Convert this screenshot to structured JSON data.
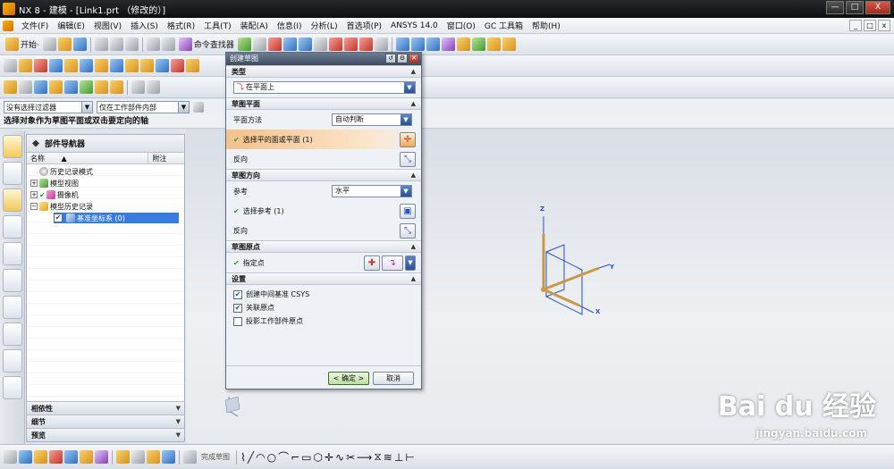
{
  "window": {
    "title": "NX 8 - 建模 - [Link1.prt （修改的）]",
    "s_char": "S",
    "buttons": [
      "—",
      "□",
      "X"
    ]
  },
  "menu": {
    "items": [
      "文件(F)",
      "编辑(E)",
      "视图(V)",
      "插入(S)",
      "格式(R)",
      "工具(T)",
      "装配(A)",
      "信息(I)",
      "分析(L)",
      "首选项(P)",
      "ANSYS 14.0",
      "窗口(O)",
      "GC 工具箱",
      "帮助(H)"
    ],
    "mdi_buttons": [
      "_",
      "□",
      "x"
    ]
  },
  "toolbar1": {
    "start_label": "开始·",
    "command_finder_label": "命令查找器"
  },
  "filterbar": {
    "filter_value": "没有选择过滤器",
    "scope_value": "仅在工作部件内部"
  },
  "cue_text": "选择对象作为草图平面或双击要定向的轴",
  "navigator": {
    "title": "部件导航器",
    "col_name": "名称",
    "col_sort": "▲",
    "col_note": "附注",
    "nodes": [
      {
        "label": "历史记录模式"
      },
      {
        "label": "模型视图"
      },
      {
        "label": "摄像机"
      },
      {
        "label": "模型历史记录"
      },
      {
        "label": "基准坐标系 (0)"
      }
    ],
    "sections": [
      "相依性",
      "细节",
      "预览"
    ]
  },
  "dialog": {
    "title": "创建草图",
    "type_header": "类型",
    "type_value": "在平面上",
    "plane_header": "草图平面",
    "plane_method_label": "平面方法",
    "plane_method_value": "自动判断",
    "select_face_label": "选择平的面或平面 (1)",
    "reverse_label": "反向",
    "dir_header": "草图方向",
    "ref_label": "参考",
    "ref_value": "水平",
    "select_ref_label": "选择参考 (1)",
    "reverse2_label": "反向",
    "origin_header": "草图原点",
    "specify_point_label": "指定点",
    "settings_header": "设置",
    "opt_intermediate": "创建中间基准 CSYS",
    "opt_assoc_origin": "关联原点",
    "opt_project_origin": "投影工作部件原点",
    "ok_label": "< 确定 >",
    "cancel_label": "取消"
  },
  "csys": {
    "z": "Z",
    "y": "Y",
    "x": "X"
  },
  "bottombar": {
    "finish_label": "完成草图"
  },
  "watermark": {
    "main": "Bai du 经验",
    "sub": "jingyan.baidu.com"
  }
}
